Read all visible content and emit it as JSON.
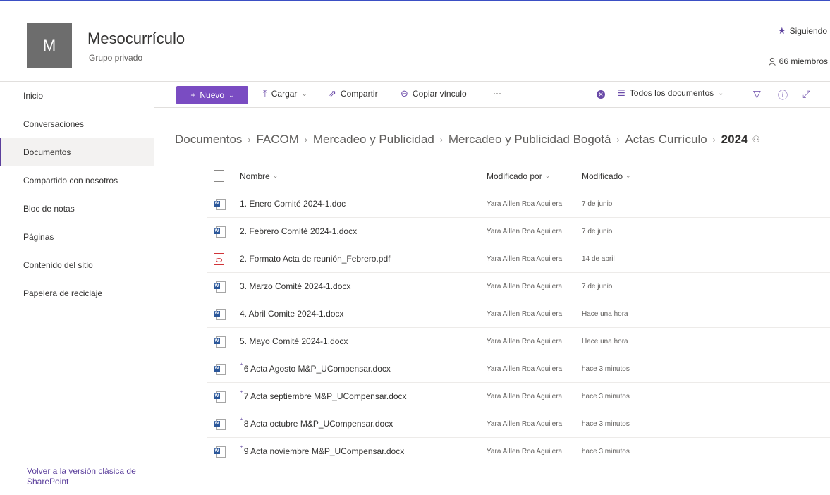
{
  "site": {
    "logo_letter": "M",
    "title": "Mesocurrículo",
    "subtitle": "Grupo privado",
    "follow_label": "Siguiendo",
    "members_label": "66 miembros"
  },
  "nav": {
    "items": [
      {
        "label": "Inicio"
      },
      {
        "label": "Conversaciones"
      },
      {
        "label": "Documentos"
      },
      {
        "label": "Compartido con nosotros"
      },
      {
        "label": "Bloc de notas"
      },
      {
        "label": "Páginas"
      },
      {
        "label": "Contenido del sitio"
      },
      {
        "label": "Papelera de reciclaje"
      }
    ],
    "active": "Documentos",
    "classic_link": "Volver a la versión clásica de SharePoint"
  },
  "commandbar": {
    "new_label": "Nuevo",
    "upload_label": "Cargar",
    "share_label": "Compartir",
    "copy_link_label": "Copiar vínculo",
    "more_label": "···",
    "view_label": "Todos los documentos"
  },
  "breadcrumb": {
    "items": [
      "Documentos",
      "FACOM",
      "Mercadeo y Publicidad",
      "Mercadeo y Publicidad Bogotá",
      "Actas Currículo"
    ],
    "current": "2024"
  },
  "table": {
    "headers": {
      "name": "Nombre",
      "modified_by": "Modificado por",
      "modified": "Modificado"
    },
    "rows": [
      {
        "type": "word",
        "name": "1. Enero Comité 2024-1.doc",
        "modified_by": "Yara Aillen Roa Aguilera",
        "modified": "7 de junio",
        "new": false
      },
      {
        "type": "word",
        "name": "2. Febrero Comité 2024-1.docx",
        "modified_by": "Yara Aillen Roa Aguilera",
        "modified": "7 de junio",
        "new": false
      },
      {
        "type": "pdf",
        "name": "2. Formato Acta de reunión_Febrero.pdf",
        "modified_by": "Yara Aillen Roa Aguilera",
        "modified": "14 de abril",
        "new": false
      },
      {
        "type": "word",
        "name": "3. Marzo Comité 2024-1.docx",
        "modified_by": "Yara Aillen Roa Aguilera",
        "modified": "7 de junio",
        "new": false
      },
      {
        "type": "word",
        "name": "4. Abril Comite 2024-1.docx",
        "modified_by": "Yara Aillen Roa Aguilera",
        "modified": "Hace una hora",
        "new": false
      },
      {
        "type": "word",
        "name": "5. Mayo Comité 2024-1.docx",
        "modified_by": "Yara Aillen Roa Aguilera",
        "modified": "Hace una hora",
        "new": false
      },
      {
        "type": "word",
        "name": "6 Acta Agosto M&P_UCompensar.docx",
        "modified_by": "Yara Aillen Roa Aguilera",
        "modified": "hace 3 minutos",
        "new": true
      },
      {
        "type": "word",
        "name": "7 Acta septiembre M&P_UCompensar.docx",
        "modified_by": "Yara Aillen Roa Aguilera",
        "modified": "hace 3 minutos",
        "new": true
      },
      {
        "type": "word",
        "name": "8 Acta octubre M&P_UCompensar.docx",
        "modified_by": "Yara Aillen Roa Aguilera",
        "modified": "hace 3 minutos",
        "new": true
      },
      {
        "type": "word",
        "name": "9 Acta noviembre M&P_UCompensar.docx",
        "modified_by": "Yara Aillen Roa Aguilera",
        "modified": "hace 3 minutos",
        "new": true
      }
    ]
  },
  "colors": {
    "accent": "#7a4cc2",
    "word": "#2b579a",
    "pdf": "#d13438"
  }
}
